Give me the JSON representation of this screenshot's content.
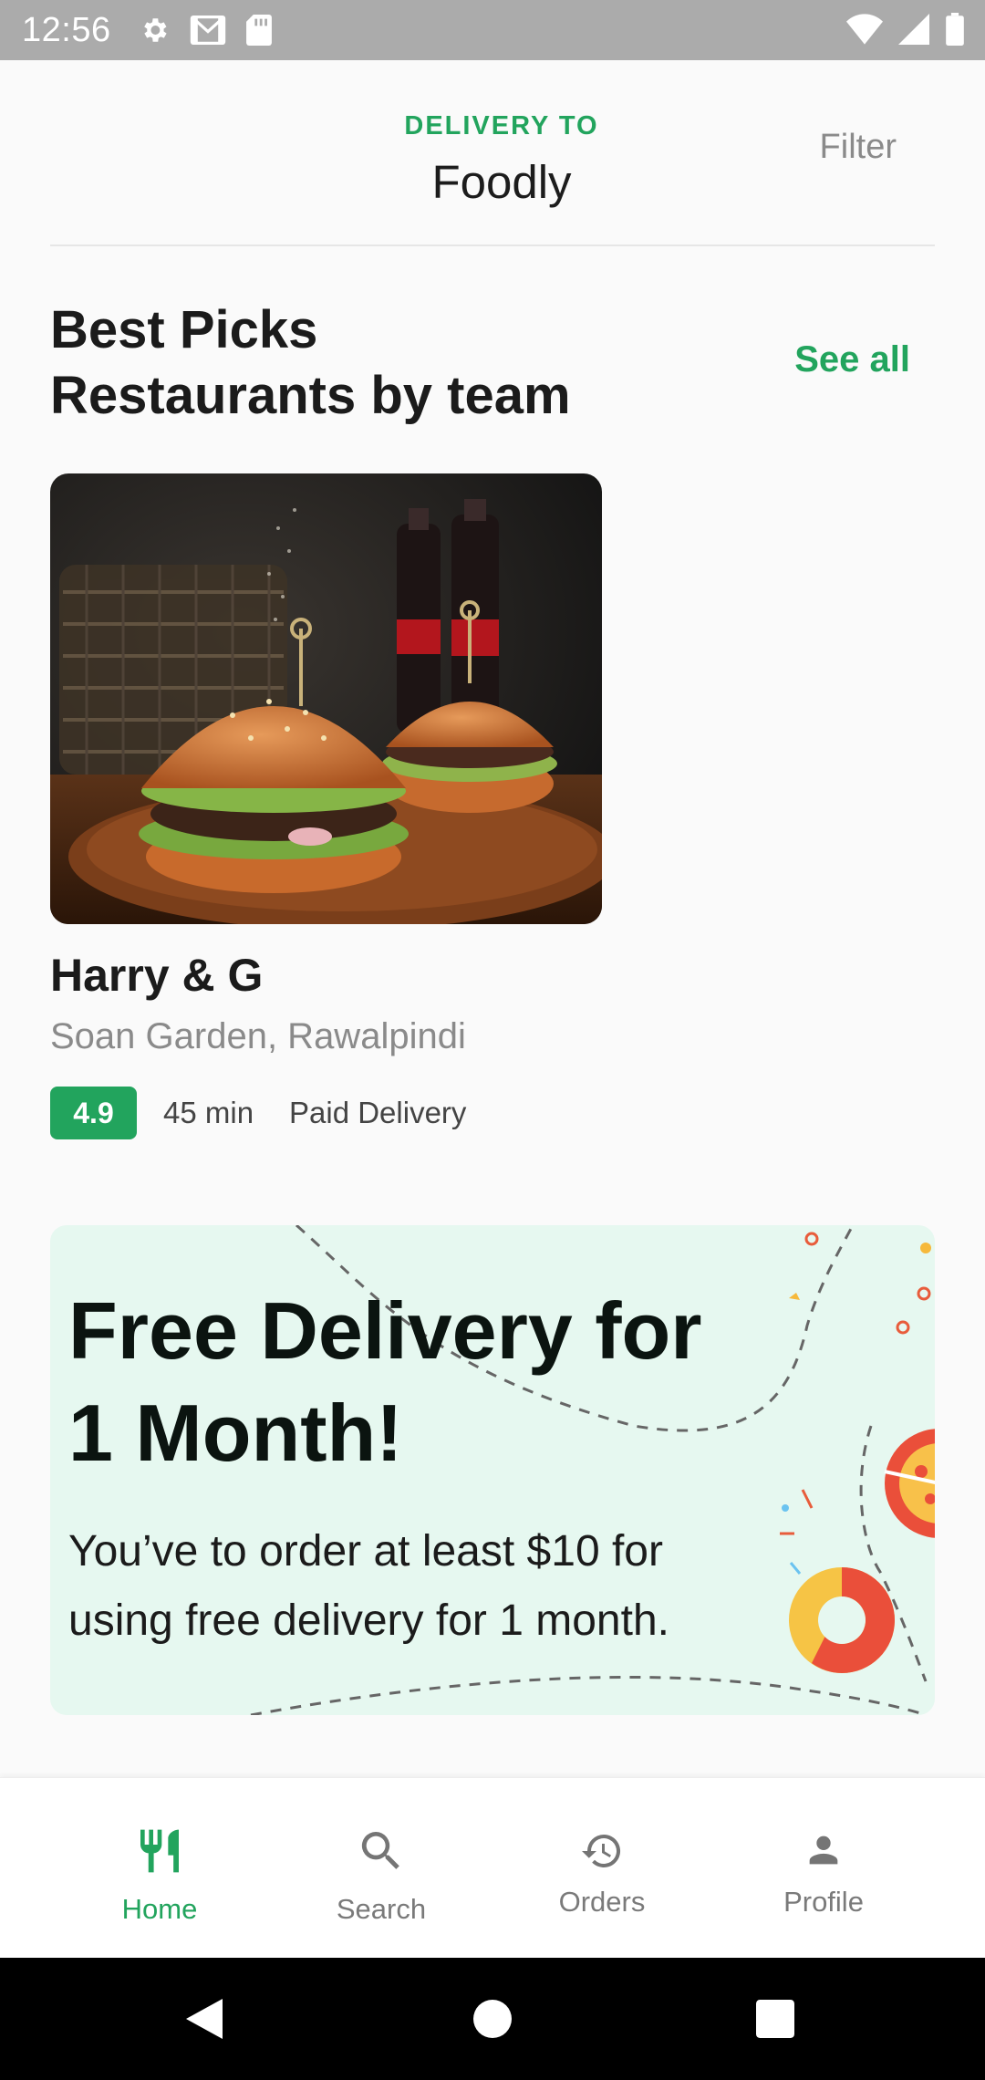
{
  "status_bar": {
    "time": "12:56"
  },
  "header": {
    "delivery_label": "DELIVERY TO",
    "location": "Foodly",
    "filter_label": "Filter"
  },
  "section": {
    "title_line1": "Best Picks",
    "title_line2": "Restaurants by team",
    "see_all_label": "See all"
  },
  "restaurant": {
    "name": "Harry & G",
    "address": "Soan Garden, Rawalpindi",
    "rating": "4.9",
    "time": "45 min",
    "delivery": "Paid Delivery"
  },
  "promo": {
    "title_line1": "Free Delivery for",
    "title_line2": "1 Month!",
    "text_line1": "You’ve to order at least $10 for",
    "text_line2": "using free delivery for 1 month."
  },
  "bottom_nav": {
    "items": [
      {
        "label": "Home",
        "icon": "fork-knife-icon",
        "active": true
      },
      {
        "label": "Search",
        "icon": "search-icon",
        "active": false
      },
      {
        "label": "Orders",
        "icon": "history-icon",
        "active": false
      },
      {
        "label": "Profile",
        "icon": "person-icon",
        "active": false
      }
    ]
  },
  "colors": {
    "accent": "#22a45d",
    "banner_bg": "#e6f8f0",
    "status_bar": "#ababab"
  }
}
